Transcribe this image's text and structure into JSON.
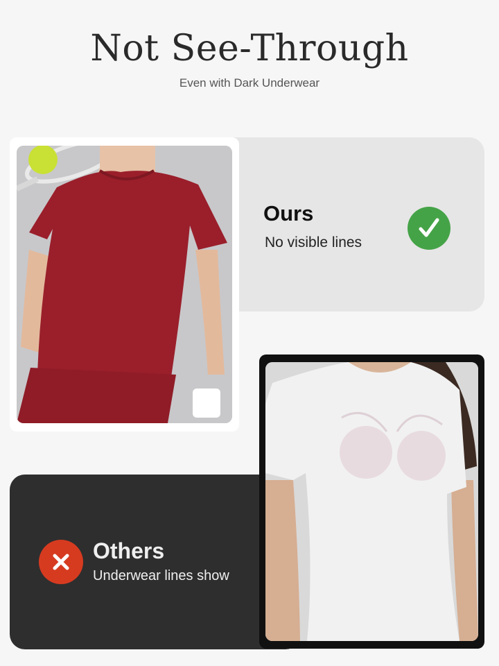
{
  "header": {
    "title": "Not See-Through",
    "subtitle": "Even with Dark Underwear"
  },
  "ours": {
    "label": "Ours",
    "description": "No visible lines",
    "icon": "check-icon",
    "badge_color": "#45a347",
    "photo_subject": "red-tshirt-photo"
  },
  "others": {
    "label": "Others",
    "description": "Underwear lines show",
    "icon": "x-icon",
    "badge_color": "#d63b20",
    "photo_subject": "white-tshirt-photo"
  },
  "colors": {
    "background": "#f6f6f6",
    "ours_card": "#e6e6e6",
    "others_card": "#2e2e2e",
    "shirt_red": "#9a1f2b",
    "shirt_white": "#f2f2f2"
  }
}
